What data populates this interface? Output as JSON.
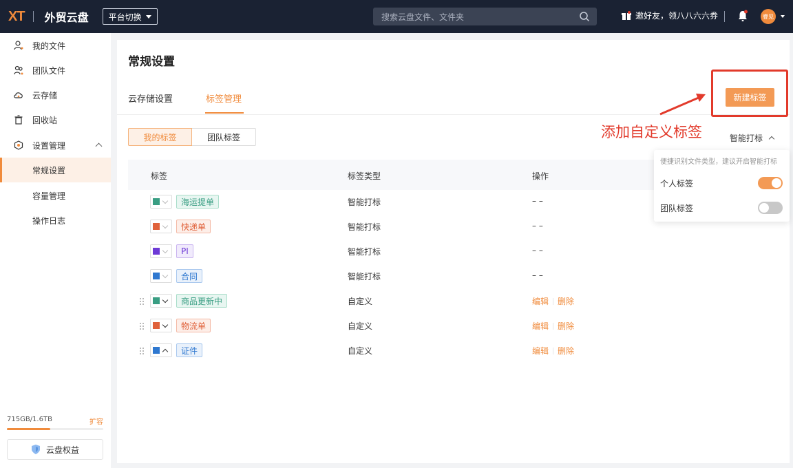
{
  "header": {
    "logo": "XT",
    "app_title": "外贸云盘",
    "platform_switch": "平台切换",
    "search_placeholder": "搜索云盘文件、文件夹",
    "invite_text": "邀好友，领八八六六券",
    "avatar_text": "睿见"
  },
  "sidebar": {
    "items": [
      {
        "label": "我的文件",
        "icon": "user-file-icon"
      },
      {
        "label": "团队文件",
        "icon": "team-file-icon"
      },
      {
        "label": "云存储",
        "icon": "cloud-icon"
      },
      {
        "label": "回收站",
        "icon": "trash-icon"
      },
      {
        "label": "设置管理",
        "icon": "settings-icon"
      }
    ],
    "sub_items": [
      {
        "label": "常规设置",
        "active": true
      },
      {
        "label": "容量管理"
      },
      {
        "label": "操作日志"
      }
    ],
    "storage_text": "715GB/1.6TB",
    "storage_used_fraction": 0.45,
    "expand_label": "扩容",
    "benefit_label": "云盘权益"
  },
  "main": {
    "title": "常规设置",
    "tabs": [
      {
        "label": "云存储设置"
      },
      {
        "label": "标签管理",
        "active": true
      }
    ],
    "new_tag_label": "新建标签",
    "annotation": "添加自定义标签",
    "segments": [
      {
        "label": "我的标签",
        "active": true
      },
      {
        "label": "团队标签"
      }
    ],
    "smart_label": "智能打标",
    "table": {
      "headers": [
        "标签",
        "标签类型",
        "操作"
      ],
      "rows": [
        {
          "tag": "海运提单",
          "color": "#3a9e83",
          "chip_bg": "#e8f6f1",
          "chip_border": "#a8ddc9",
          "chip_color": "#3a9e83",
          "type": "智能打标",
          "op": "– –",
          "custom": false
        },
        {
          "tag": "快递单",
          "color": "#e0623b",
          "chip_bg": "#fdeee8",
          "chip_border": "#f4b9a5",
          "chip_color": "#e0623b",
          "type": "智能打标",
          "op": "– –",
          "custom": false
        },
        {
          "tag": "PI",
          "color": "#6d3ad6",
          "chip_bg": "#f1ebfc",
          "chip_border": "#c9b3f0",
          "chip_color": "#6d3ad6",
          "type": "智能打标",
          "op": "– –",
          "custom": false
        },
        {
          "tag": "合同",
          "color": "#2f78d0",
          "chip_bg": "#e9f1fb",
          "chip_border": "#a9c8ee",
          "chip_color": "#2f78d0",
          "type": "智能打标",
          "op": "– –",
          "custom": false
        },
        {
          "tag": "商品更新中",
          "color": "#3a9e83",
          "chip_bg": "#e8f6f1",
          "chip_border": "#a8ddc9",
          "chip_color": "#3a9e83",
          "type": "自定义",
          "custom": true
        },
        {
          "tag": "物流单",
          "color": "#e0623b",
          "chip_bg": "#fdeee8",
          "chip_border": "#f4b9a5",
          "chip_color": "#e0623b",
          "type": "自定义",
          "custom": true
        },
        {
          "tag": "证件",
          "color": "#2f78d0",
          "chip_bg": "#e9f1fb",
          "chip_border": "#a9c8ee",
          "chip_color": "#2f78d0",
          "type": "自定义",
          "custom": true
        }
      ],
      "edit_label": "编辑",
      "delete_label": "删除"
    },
    "popover": {
      "hint": "便捷识别文件类型，建议开启智能打标",
      "personal_label": "个人标签",
      "personal_on": true,
      "team_label": "团队标签",
      "team_on": false
    }
  },
  "colors": {
    "accent": "#f08b3c",
    "topbar": "#1a2233",
    "annotation_red": "#e23a2b"
  }
}
